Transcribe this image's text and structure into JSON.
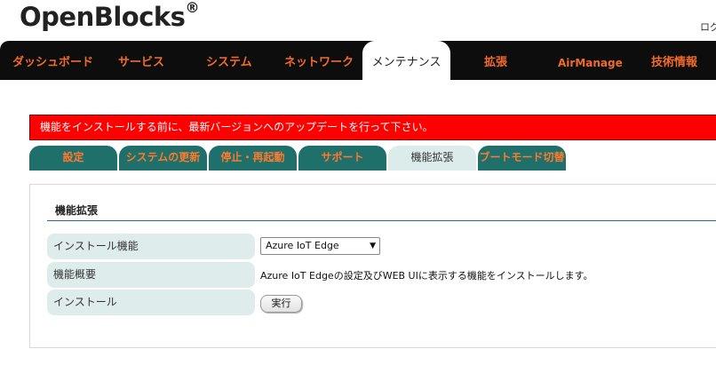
{
  "header": {
    "logo": "OpenBlocks",
    "logo_mark": "®",
    "login_label": "ログ"
  },
  "nav": {
    "items": [
      {
        "label": "ダッシュボード"
      },
      {
        "label": "サービス"
      },
      {
        "label": "システム"
      },
      {
        "label": "ネットワーク"
      },
      {
        "label": "メンテナンス",
        "active": true
      },
      {
        "label": "拡張"
      },
      {
        "label": "AirManage"
      },
      {
        "label": "技術情報"
      }
    ]
  },
  "alert": {
    "message": "機能をインストールする前に、最新バージョンへのアップデートを行って下さい。",
    "color": "#ff0000"
  },
  "tabs": [
    {
      "label": "設定"
    },
    {
      "label": "システムの更新"
    },
    {
      "label": "停止・再起動"
    },
    {
      "label": "サポート"
    },
    {
      "label": "機能拡張",
      "active": true
    },
    {
      "label": "ブートモード切替"
    }
  ],
  "panel": {
    "title": "機能拡張",
    "rows": {
      "install_feature": {
        "label": "インストール機能",
        "selected": "Azure IoT Edge"
      },
      "overview": {
        "label": "機能概要",
        "value": "Azure IoT Edgeの設定及びWEB UIに表示する機能をインストールします。"
      },
      "install": {
        "label": "インストール",
        "button": "実行"
      }
    }
  },
  "colors": {
    "navbar": "#0d0d0d",
    "nav_text": "#f26b2a",
    "tab_bg": "#1f6f6a",
    "tab_active_bg": "#dceceb",
    "label_bg": "#deeceb"
  }
}
